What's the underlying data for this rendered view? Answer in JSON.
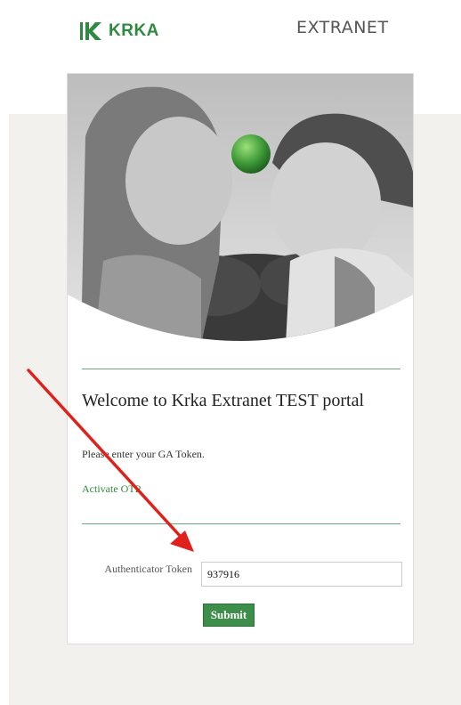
{
  "header": {
    "logo_text": "KRKA",
    "section_title": "EXTRANET"
  },
  "card": {
    "title": "Welcome to Krka Extranet TEST portal",
    "subtitle": "Please enter your GA Token.",
    "activate_link": "Activate OTP",
    "token_label": "Authenticator Token",
    "token_value": "937916",
    "submit_label": "Submit"
  },
  "colors": {
    "brand_green": "#2f8a41",
    "button_green": "#3e8e4b",
    "background_panel": "#f2f1ed",
    "annotation_arrow": "#e0201b"
  },
  "icons": {
    "logo_mark": "krka-logo-icon",
    "annotation": "red-arrow-icon"
  }
}
